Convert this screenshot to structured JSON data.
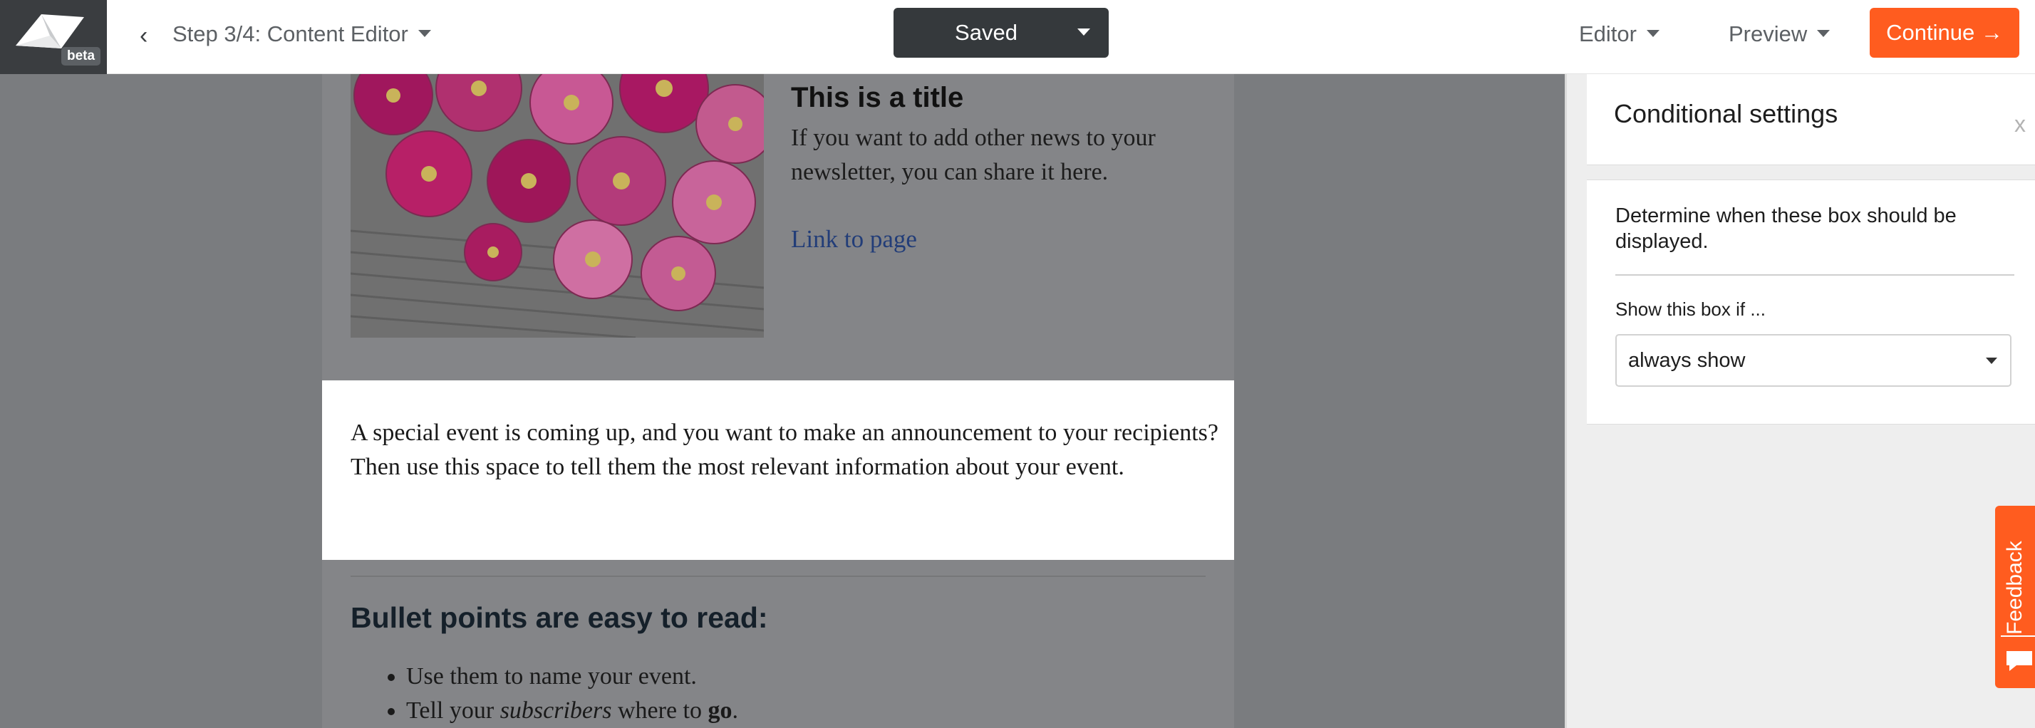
{
  "header": {
    "logo_badge": "beta",
    "back_glyph": "‹",
    "step_label": "Step 3/4: Content Editor",
    "save_status": "Saved",
    "editor_menu": "Editor",
    "preview_menu": "Preview",
    "continue_label": "Continue →",
    "accent_color": "#ff5c1f",
    "save_button_color": "#35393c"
  },
  "email": {
    "news_title": "This is a title",
    "news_text": "If you want to add other news to your newsletter, you can share it here.",
    "news_link": "Link to page",
    "event_text": "A special event is coming up, and you want to make an announcement to your recipients? Then use this space to tell them the most relevant information about your event.",
    "bullets_heading": "Bullet points are easy to read:",
    "bullet_1": "Use them to name your event.",
    "bullet_2_before": "Tell your ",
    "bullet_2_em": "subscribers",
    "bullet_2_middle": " where to ",
    "bullet_2_strong": "go",
    "bullet_2_after": "."
  },
  "panel": {
    "title": "Conditional settings",
    "close_label": "x",
    "description": "Determine when these box should be displayed.",
    "show_if_label": "Show this box if ...",
    "select_value": "always show"
  },
  "feedback": {
    "label": "Feedback"
  }
}
